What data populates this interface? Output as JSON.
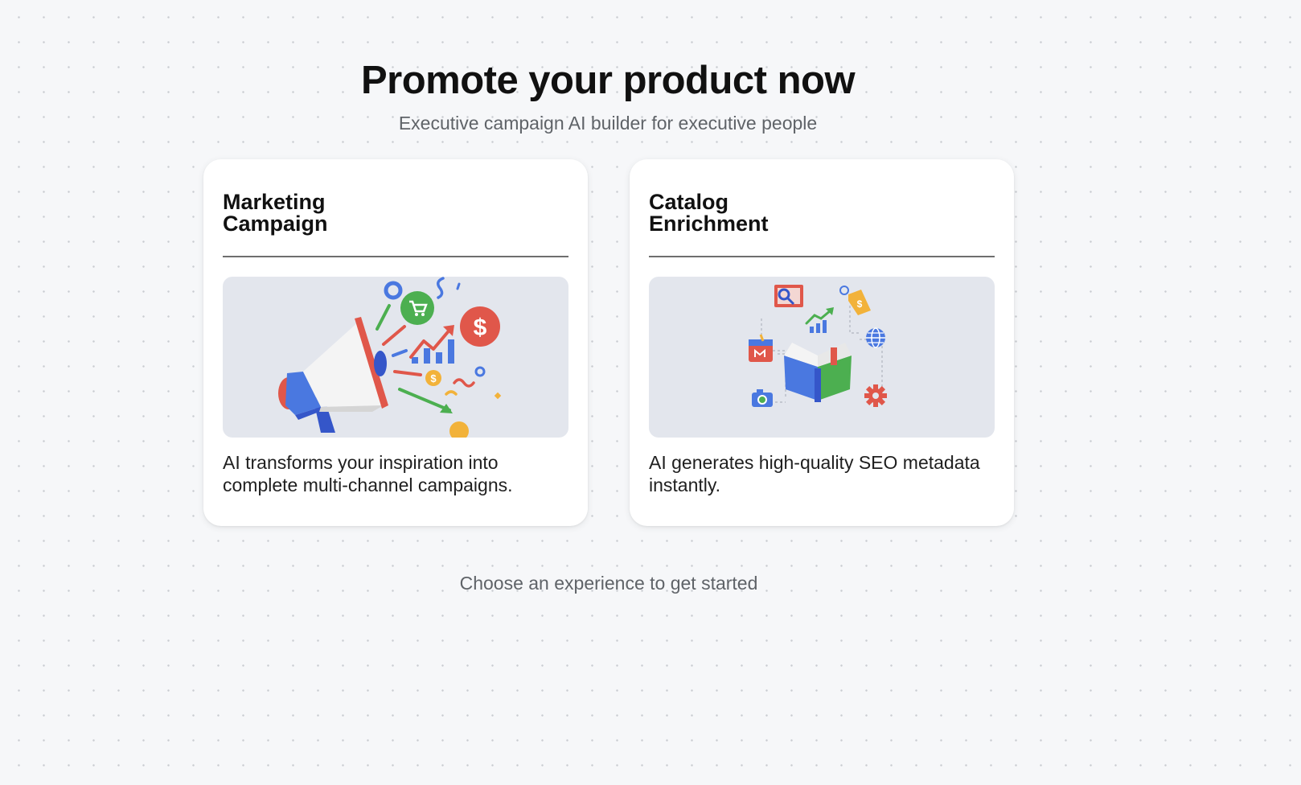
{
  "header": {
    "title": "Promote your product now",
    "subtitle": "Executive campaign AI builder for executive people"
  },
  "cards": [
    {
      "title_line1": "Marketing",
      "title_line2": "Campaign",
      "description": "AI transforms your inspiration into complete multi-channel campaigns.",
      "illustration": "megaphone-illustration"
    },
    {
      "title_line1": "Catalog",
      "title_line2": "Enrichment",
      "description": "AI generates high-quality SEO metadata instantly.",
      "illustration": "book-illustration"
    }
  ],
  "footer": {
    "hint": "Choose an experience to get started"
  },
  "colors": {
    "background": "#f6f7f9",
    "card": "#ffffff",
    "illustration_bg": "#e3e6ed",
    "blue": "#4a78e0",
    "red": "#e0574a",
    "green": "#4caf50",
    "yellow": "#f2b23a"
  }
}
